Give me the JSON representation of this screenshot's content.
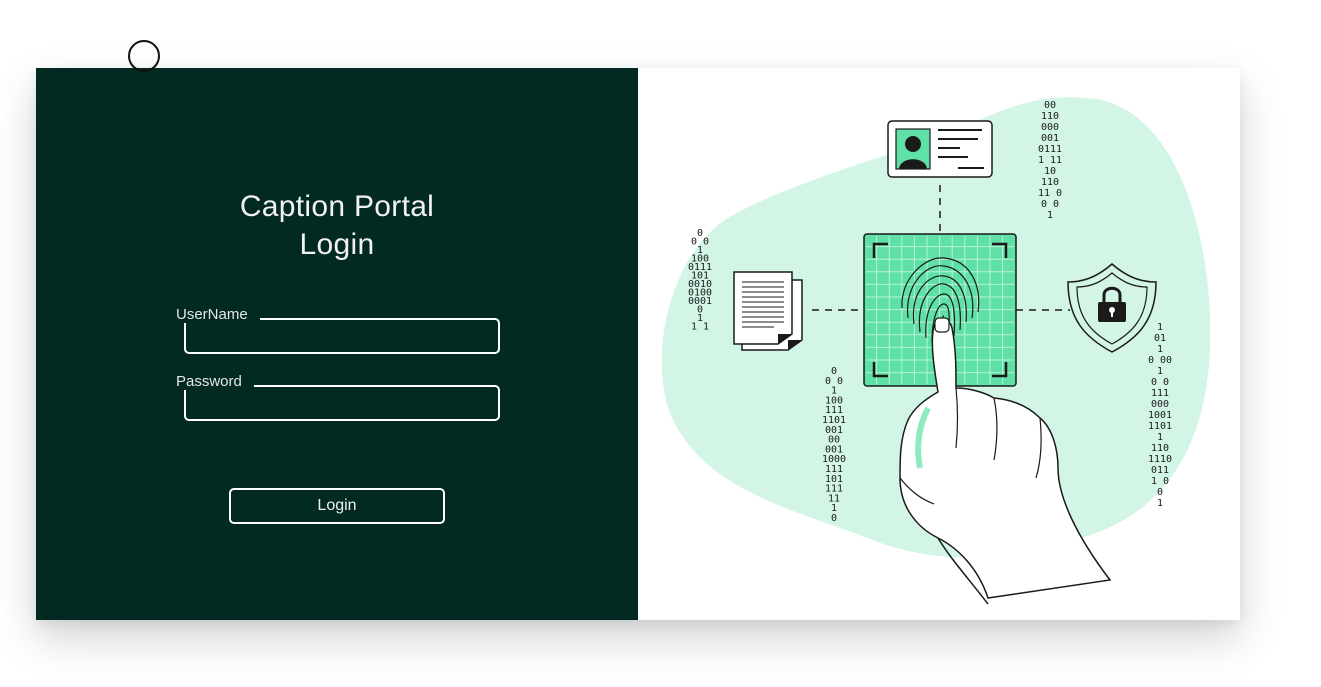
{
  "login_panel": {
    "title_line1": "Caption Portal",
    "title_line2": "Login",
    "username_label": "UserName",
    "username_value": "",
    "password_label": "Password",
    "password_value": "",
    "login_button": "Login"
  },
  "colors": {
    "panel_bg": "#022a22",
    "accent_green": "#5fe0a6",
    "blob_green": "#d2f5e6",
    "line": "#1a1a1a"
  },
  "illustration": {
    "binary_left_top": [
      "0",
      "0 0",
      "1",
      "100",
      "0111",
      "101",
      "0010",
      "0100",
      "0001",
      "0",
      "1",
      "1 1"
    ],
    "binary_center": [
      "0",
      "0 0",
      "1",
      "100",
      "111",
      "1101",
      "001",
      "00",
      "001",
      "1000",
      "111",
      "101",
      "111",
      "11",
      "1",
      "0"
    ],
    "binary_top_right": [
      "00",
      "110",
      "000",
      "001",
      "0111",
      "1 11",
      "10",
      "110",
      "11 0",
      "0 0",
      "1"
    ],
    "binary_right": [
      "1",
      "01",
      "1",
      "0 00",
      "1",
      "0 0",
      "111",
      "000",
      "1001",
      "1101",
      "1",
      "110",
      "1110",
      "011",
      "1 0",
      "0",
      "1"
    ]
  }
}
